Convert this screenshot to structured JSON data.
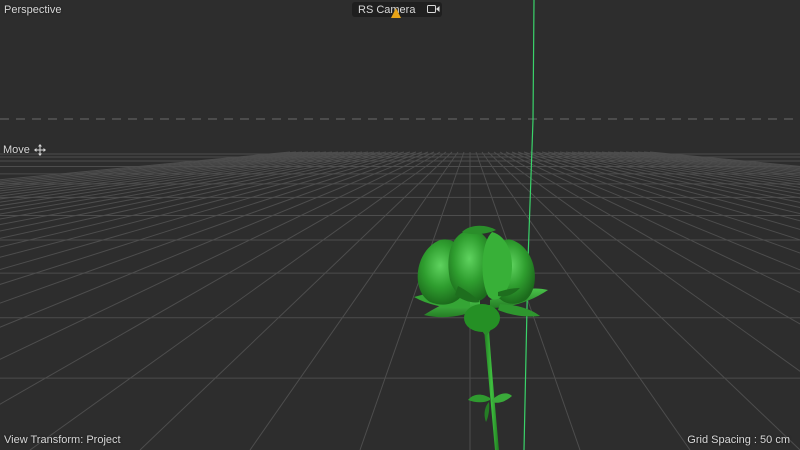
{
  "viewport": {
    "view_name": "Perspective",
    "camera": "RS Camera",
    "tool": "Move",
    "view_transform": "View Transform: Project",
    "grid_spacing": "Grid Spacing : 50 cm"
  },
  "icons": {
    "camera": "camera-icon",
    "warning": "warning-icon",
    "move": "move-icon"
  },
  "colors": {
    "background": "#2d2d2d",
    "grid_line": "#4a4a4a",
    "horizon_dash": "#6a6a6a",
    "object_green": "#2e9e2e",
    "axis_green": "#39d06a",
    "warning": "#e8a317"
  }
}
